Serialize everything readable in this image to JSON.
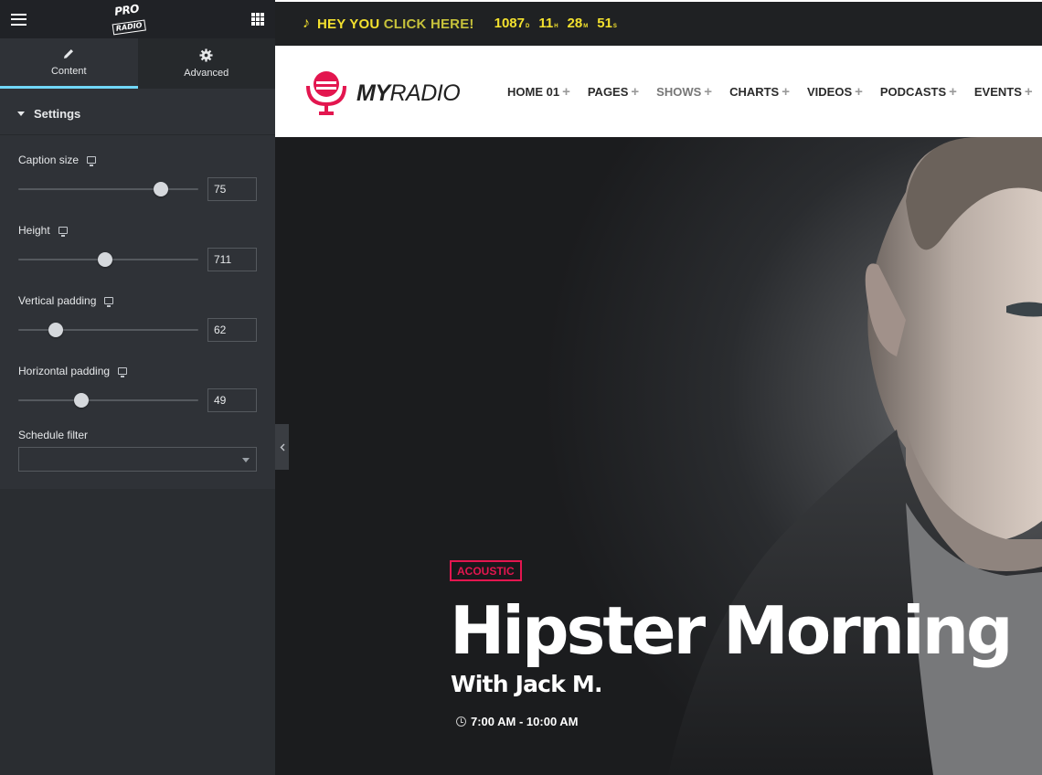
{
  "sidebar": {
    "logo": {
      "line1": "PRO",
      "line2": "RADIO"
    },
    "tabs": [
      {
        "label": "Content",
        "icon": "pencil-icon",
        "active": true
      },
      {
        "label": "Advanced",
        "icon": "gear-icon",
        "active": false
      }
    ],
    "section_title": "Settings",
    "controls": [
      {
        "label": "Caption size",
        "value": "75",
        "slider_fraction": 0.79
      },
      {
        "label": "Height",
        "value": "711",
        "slider_fraction": 0.48
      },
      {
        "label": "Vertical padding",
        "value": "62",
        "slider_fraction": 0.21
      },
      {
        "label": "Horizontal padding",
        "value": "49",
        "slider_fraction": 0.35
      }
    ],
    "schedule_filter": {
      "label": "Schedule filter",
      "value": ""
    }
  },
  "topbar": {
    "hey": "HEY YOU",
    "click": "CLICK HERE!",
    "countdown": [
      {
        "value": "1087",
        "unit": "D"
      },
      {
        "value": "11",
        "unit": "H"
      },
      {
        "value": "28",
        "unit": "M"
      },
      {
        "value": "51",
        "unit": "S"
      }
    ]
  },
  "header": {
    "brand_bold": "MY",
    "brand_light": "RADIO",
    "nav": [
      {
        "label": "HOME 01"
      },
      {
        "label": "PAGES"
      },
      {
        "label": "SHOWS"
      },
      {
        "label": "CHARTS"
      },
      {
        "label": "VIDEOS"
      },
      {
        "label": "PODCASTS"
      },
      {
        "label": "EVENTS"
      }
    ]
  },
  "hero": {
    "tag": "ACOUSTIC",
    "title": "Hipster Morning",
    "subtitle": "With Jack M.",
    "time": "7:00 AM - 10:00 AM"
  },
  "colors": {
    "accent": "#e3164f",
    "topbar_yellow": "#f2e02e",
    "tab_underline": "#71d7f7",
    "panel_bg": "#2f3237"
  }
}
